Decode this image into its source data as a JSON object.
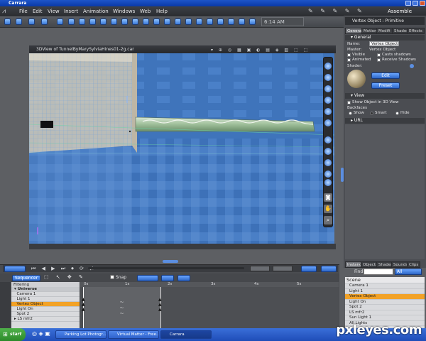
{
  "app": {
    "title": "Carrara",
    "room": "Assemble",
    "clock": "6:14 AM"
  },
  "menu": [
    "File",
    "Edit",
    "View",
    "Insert",
    "Animation",
    "Windows",
    "Web",
    "Help"
  ],
  "viewport": {
    "title": "3DView of TunnelByMarySylviaHines01-2g.car"
  },
  "properties": {
    "title": "Vertex Object : Primitive",
    "tabs": [
      "General",
      "Motion",
      "Modifi",
      "Shader",
      "Effects"
    ],
    "general_header": "General",
    "name_label": "Name:",
    "name_value": "Vertex Object",
    "master_label": "Master:",
    "master_value": "Vertex Object",
    "visible": "Visible",
    "casts_shadows": "Casts shadows",
    "animated": "Animated",
    "receive_shadows": "Receive Shadows",
    "shader_label": "Shader:",
    "edit_button": "Edit",
    "preset_button": "Preset",
    "view_header": "View",
    "show_object": "Show Object in 3D View",
    "backfaces": "Backfaces",
    "bf_show": "Show",
    "bf_smart": "Smart",
    "bf_hide": "Hide",
    "url_header": "URL"
  },
  "scene": {
    "tabs": [
      "Instances",
      "Objects",
      "Shaders",
      "Sounds",
      "Clips"
    ],
    "find_label": "Find",
    "find_select": "All",
    "root": "Scene",
    "items": [
      "Camera 1",
      "Light 1",
      "Vertex Object",
      "Light On",
      "Spot 2",
      "LS mfr2",
      "Sun Light 1",
      "All Lights"
    ],
    "selected_index": 2
  },
  "timeline": {
    "sequencer_label": "Sequencer",
    "filtering_label": "Filtering",
    "snap_label": "Snap",
    "root": "Universe",
    "rows": [
      "Camera 1",
      "Light 1",
      "Vertex Object",
      "Light On",
      "Spot 2",
      "LS mfr2"
    ],
    "selected_index": 2,
    "ruler": [
      "0s",
      "1s",
      "2s",
      "3s",
      "4s",
      "5s"
    ]
  },
  "taskbar": {
    "start": "start",
    "items": [
      "Parking Lot Photogr...",
      "Virtual Matter - Free...",
      "Carrara"
    ],
    "active_index": 2
  },
  "watermark": "pxleyes.com"
}
